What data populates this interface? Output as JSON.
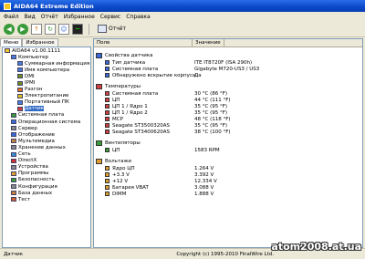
{
  "window": {
    "title": "AIDA64 Extreme Edition"
  },
  "menu": [
    "Файл",
    "Вид",
    "Отчёт",
    "Избранное",
    "Сервис",
    "Справка"
  ],
  "toolbar": {
    "report_label": "Отчёт"
  },
  "left_tabs": [
    "Меню",
    "Избранное"
  ],
  "tree": [
    {
      "label": "AIDA64 v1.00.1111",
      "indent": 0,
      "icon": "app-icon",
      "color": "#f3c623"
    },
    {
      "label": "Компьютер",
      "indent": 1,
      "icon": "computer-icon",
      "color": "#4a7bd8"
    },
    {
      "label": "Суммарная информация",
      "indent": 2,
      "icon": "summary-icon",
      "color": "#4a7bd8"
    },
    {
      "label": "Имя компьютера",
      "indent": 2,
      "icon": "computer-name-icon",
      "color": "#4a7bd8"
    },
    {
      "label": "DMI",
      "indent": 2,
      "icon": "dmi-icon",
      "color": "#6b8e23"
    },
    {
      "label": "IPMI",
      "indent": 2,
      "icon": "ipmi-icon",
      "color": "#6b8e23"
    },
    {
      "label": "Разгон",
      "indent": 2,
      "icon": "overclock-icon",
      "color": "#e07020"
    },
    {
      "label": "Электропитание",
      "indent": 2,
      "icon": "power-icon",
      "color": "#e0c020"
    },
    {
      "label": "Портативный ПК",
      "indent": 2,
      "icon": "laptop-icon",
      "color": "#4a7bd8"
    },
    {
      "label": "Датчик",
      "indent": 2,
      "icon": "sensor-icon",
      "color": "#d04040",
      "selected": true
    },
    {
      "label": "Системная плата",
      "indent": 1,
      "icon": "motherboard-icon",
      "color": "#3a9a3a"
    },
    {
      "label": "Операционная система",
      "indent": 1,
      "icon": "os-icon",
      "color": "#3a6ad8"
    },
    {
      "label": "Сервер",
      "indent": 1,
      "icon": "server-icon",
      "color": "#888888"
    },
    {
      "label": "Отображение",
      "indent": 1,
      "icon": "display-icon",
      "color": "#3a6ad8"
    },
    {
      "label": "Мультимедиа",
      "indent": 1,
      "icon": "multimedia-icon",
      "color": "#c08040"
    },
    {
      "label": "Хранение данных",
      "indent": 1,
      "icon": "storage-icon",
      "color": "#888888"
    },
    {
      "label": "Сеть",
      "indent": 1,
      "icon": "network-icon",
      "color": "#3a8ad8"
    },
    {
      "label": "DirectX",
      "indent": 1,
      "icon": "directx-icon",
      "color": "#d03030"
    },
    {
      "label": "Устройства",
      "indent": 1,
      "icon": "devices-icon",
      "color": "#888888"
    },
    {
      "label": "Программы",
      "indent": 1,
      "icon": "programs-icon",
      "color": "#e0a030"
    },
    {
      "label": "Безопасность",
      "indent": 1,
      "icon": "security-icon",
      "color": "#3a9a3a"
    },
    {
      "label": "Конфигурация",
      "indent": 1,
      "icon": "config-icon",
      "color": "#888888"
    },
    {
      "label": "База данных",
      "indent": 1,
      "icon": "database-icon",
      "color": "#c08040"
    },
    {
      "label": "Тест",
      "indent": 1,
      "icon": "benchmark-icon",
      "color": "#d06030"
    }
  ],
  "columns": {
    "field": "Поле",
    "value": "Значение"
  },
  "sections": [
    {
      "title": "Свойства датчика",
      "icon": "sensor-props-icon",
      "rows": [
        {
          "field": "Тип датчика",
          "value": "ITE IT8720F (ISA 290h)"
        },
        {
          "field": "Системная плата",
          "value": "Gigabyte M720-US3 / US3"
        },
        {
          "field": "Обнаружено вскрытие корпуса",
          "value": "Да"
        }
      ]
    },
    {
      "title": "Температуры",
      "icon": "temperature-icon",
      "rows": [
        {
          "field": "Системная плата",
          "value": "30 °C (86 °F)"
        },
        {
          "field": "ЦП",
          "value": "44 °C (111 °F)"
        },
        {
          "field": "ЦП 1 / Ядро 1",
          "value": "35 °C (95 °F)"
        },
        {
          "field": "ЦП 1 / Ядро 2",
          "value": "35 °C (95 °F)"
        },
        {
          "field": "MCP",
          "value": "48 °C (118 °F)"
        },
        {
          "field": "Seagate ST3500320AS",
          "value": "35 °C (95 °F)"
        },
        {
          "field": "Seagate ST3400620AS",
          "value": "38 °C (100 °F)"
        }
      ]
    },
    {
      "title": "Вентиляторы",
      "icon": "fans-icon",
      "rows": [
        {
          "field": "ЦП",
          "value": "1583 RPM"
        }
      ]
    },
    {
      "title": "Вольтажи",
      "icon": "voltages-icon",
      "rows": [
        {
          "field": "Ядро ЦП",
          "value": "1.264 V"
        },
        {
          "field": "+3.3 V",
          "value": "3.392 V"
        },
        {
          "field": "+12 V",
          "value": "12.334 V"
        },
        {
          "field": "Батарея VBAT",
          "value": "3.088 V"
        },
        {
          "field": "DIMM",
          "value": "1.888 V"
        }
      ]
    }
  ],
  "status": {
    "left": "Датчик",
    "right": "Copyright (c) 1995-2010 FinalWire Ltd."
  },
  "watermark": "atom2008.at.ua"
}
